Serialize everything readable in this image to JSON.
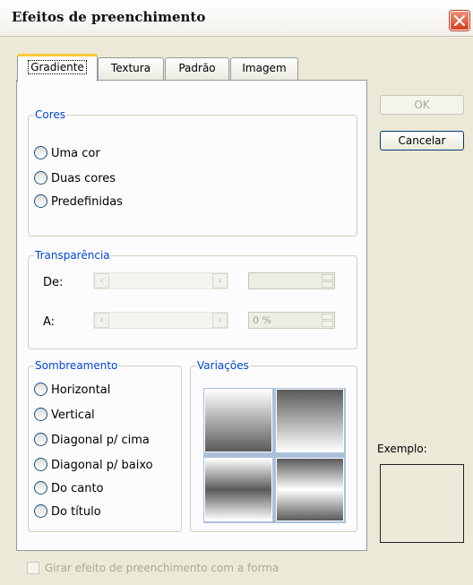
{
  "dialog": {
    "title": "Efeitos de preenchimento",
    "close_icon": "close-icon"
  },
  "tabs": [
    {
      "label": "Gradiente",
      "active": true
    },
    {
      "label": "Textura",
      "active": false
    },
    {
      "label": "Padrão",
      "active": false
    },
    {
      "label": "Imagem",
      "active": false
    }
  ],
  "cores": {
    "title": "Cores",
    "options": [
      {
        "label": "Uma cor",
        "selected": false
      },
      {
        "label": "Duas cores",
        "selected": false
      },
      {
        "label": "Predefinidas",
        "selected": false
      }
    ]
  },
  "transparencia": {
    "title": "Transparência",
    "de_label": "De:",
    "a_label": "A:",
    "de_value": "",
    "a_value": "0 %"
  },
  "sombreamento": {
    "title": "Sombreamento",
    "options": [
      {
        "label": "Horizontal",
        "selected": false
      },
      {
        "label": "Vertical",
        "selected": false
      },
      {
        "label": "Diagonal p/ cima",
        "selected": false
      },
      {
        "label": "Diagonal p/ baixo",
        "selected": false
      },
      {
        "label": "Do canto",
        "selected": false
      },
      {
        "label": "Do título",
        "selected": false
      }
    ]
  },
  "variacoes": {
    "title": "Variações",
    "count": 4
  },
  "buttons": {
    "ok": "OK",
    "ok_enabled": false,
    "cancel": "Cancelar"
  },
  "preview": {
    "label": "Exemplo:"
  },
  "rotate_checkbox": {
    "label": "Girar efeito de preenchimento com a forma",
    "checked": false,
    "enabled": false
  },
  "colors": {
    "group_title": "#0046d5",
    "active_tab_highlight": "#ffc83c",
    "dialog_background": "#ece9d8",
    "close_button": "#d4401f"
  }
}
